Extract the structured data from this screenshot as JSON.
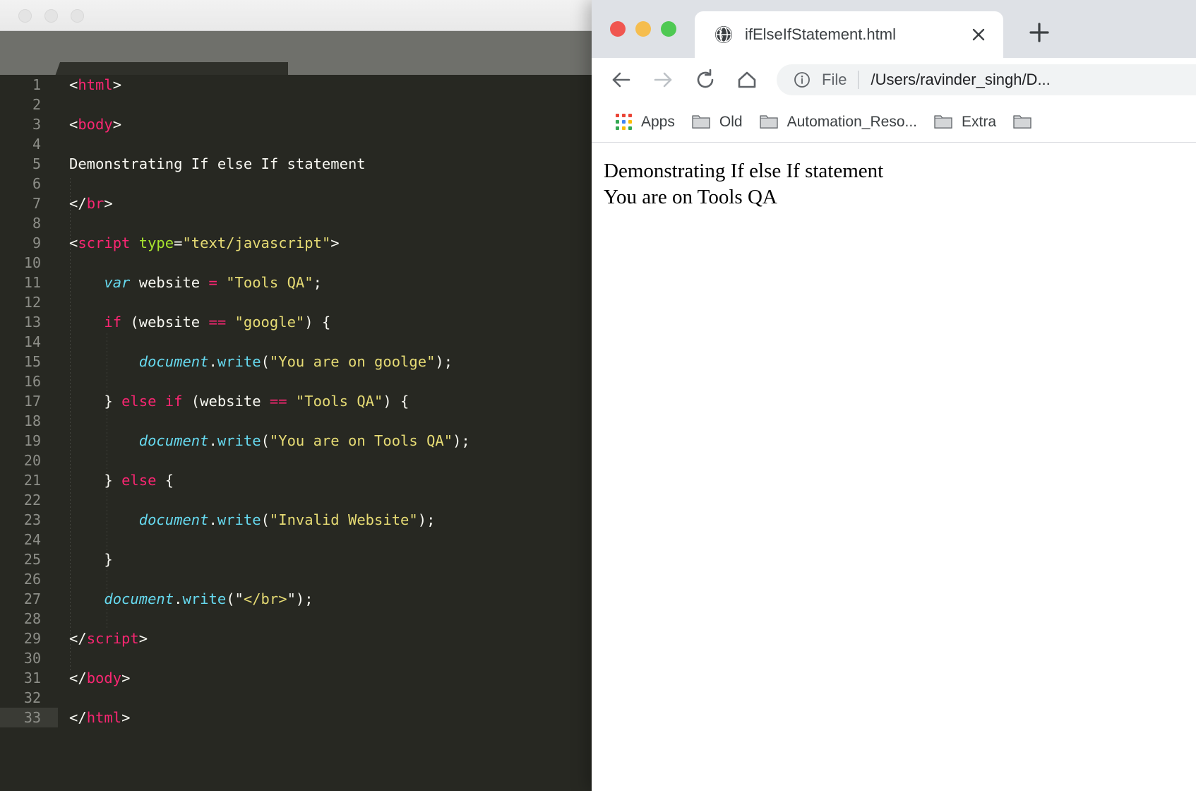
{
  "editor": {
    "window_controls": [
      "close",
      "minimize",
      "zoom"
    ],
    "nav": {
      "back_icon": "triangle-left-icon",
      "forward_icon": "triangle-right-icon"
    },
    "tab": {
      "title": "ifElseIfStatement.html",
      "close_glyph": "×"
    },
    "active_line": 33,
    "lines": [
      {
        "n": "1",
        "tokens": [
          {
            "t": "punct",
            "v": "<"
          },
          {
            "t": "tag",
            "v": "html"
          },
          {
            "t": "punct",
            "v": ">"
          }
        ]
      },
      {
        "n": "2",
        "tokens": []
      },
      {
        "n": "3",
        "tokens": [
          {
            "t": "punct",
            "v": "<"
          },
          {
            "t": "tag",
            "v": "body"
          },
          {
            "t": "punct",
            "v": ">"
          }
        ]
      },
      {
        "n": "4",
        "tokens": []
      },
      {
        "n": "5",
        "tokens": [
          {
            "t": "plain",
            "v": "Demonstrating If else If statement"
          }
        ]
      },
      {
        "n": "6",
        "tokens": []
      },
      {
        "n": "7",
        "tokens": [
          {
            "t": "punct",
            "v": "</"
          },
          {
            "t": "tag",
            "v": "br"
          },
          {
            "t": "punct",
            "v": ">"
          }
        ]
      },
      {
        "n": "8",
        "tokens": []
      },
      {
        "n": "9",
        "tokens": [
          {
            "t": "punct",
            "v": "<"
          },
          {
            "t": "tag",
            "v": "script"
          },
          {
            "t": "plain",
            "v": " "
          },
          {
            "t": "attr",
            "v": "type"
          },
          {
            "t": "punct",
            "v": "="
          },
          {
            "t": "str",
            "v": "\"text/javascript\""
          },
          {
            "t": "punct",
            "v": ">"
          }
        ]
      },
      {
        "n": "10",
        "tokens": []
      },
      {
        "n": "11",
        "tokens": [
          {
            "t": "plain",
            "v": "    "
          },
          {
            "t": "var",
            "v": "var"
          },
          {
            "t": "plain",
            "v": " website "
          },
          {
            "t": "op",
            "v": "="
          },
          {
            "t": "plain",
            "v": " "
          },
          {
            "t": "str",
            "v": "\"Tools QA\""
          },
          {
            "t": "plain",
            "v": ";"
          }
        ]
      },
      {
        "n": "12",
        "tokens": []
      },
      {
        "n": "13",
        "tokens": [
          {
            "t": "plain",
            "v": "    "
          },
          {
            "t": "kw",
            "v": "if"
          },
          {
            "t": "plain",
            "v": " (website "
          },
          {
            "t": "op",
            "v": "=="
          },
          {
            "t": "plain",
            "v": " "
          },
          {
            "t": "str",
            "v": "\"google\""
          },
          {
            "t": "plain",
            "v": ") {"
          }
        ]
      },
      {
        "n": "14",
        "tokens": []
      },
      {
        "n": "15",
        "tokens": [
          {
            "t": "plain",
            "v": "        "
          },
          {
            "t": "var",
            "v": "document"
          },
          {
            "t": "plain",
            "v": "."
          },
          {
            "t": "fn",
            "v": "write"
          },
          {
            "t": "plain",
            "v": "("
          },
          {
            "t": "str",
            "v": "\"You are on goolge\""
          },
          {
            "t": "plain",
            "v": ");"
          }
        ]
      },
      {
        "n": "16",
        "tokens": []
      },
      {
        "n": "17",
        "tokens": [
          {
            "t": "plain",
            "v": "    } "
          },
          {
            "t": "kw",
            "v": "else if"
          },
          {
            "t": "plain",
            "v": " (website "
          },
          {
            "t": "op",
            "v": "=="
          },
          {
            "t": "plain",
            "v": " "
          },
          {
            "t": "str",
            "v": "\"Tools QA\""
          },
          {
            "t": "plain",
            "v": ") {"
          }
        ]
      },
      {
        "n": "18",
        "tokens": []
      },
      {
        "n": "19",
        "tokens": [
          {
            "t": "plain",
            "v": "        "
          },
          {
            "t": "var",
            "v": "document"
          },
          {
            "t": "plain",
            "v": "."
          },
          {
            "t": "fn",
            "v": "write"
          },
          {
            "t": "plain",
            "v": "("
          },
          {
            "t": "str",
            "v": "\"You are on Tools QA\""
          },
          {
            "t": "plain",
            "v": ");"
          }
        ]
      },
      {
        "n": "20",
        "tokens": []
      },
      {
        "n": "21",
        "tokens": [
          {
            "t": "plain",
            "v": "    } "
          },
          {
            "t": "kw",
            "v": "else"
          },
          {
            "t": "plain",
            "v": " {"
          }
        ]
      },
      {
        "n": "22",
        "tokens": []
      },
      {
        "n": "23",
        "tokens": [
          {
            "t": "plain",
            "v": "        "
          },
          {
            "t": "var",
            "v": "document"
          },
          {
            "t": "plain",
            "v": "."
          },
          {
            "t": "fn",
            "v": "write"
          },
          {
            "t": "plain",
            "v": "("
          },
          {
            "t": "str",
            "v": "\"Invalid Website\""
          },
          {
            "t": "plain",
            "v": ");"
          }
        ]
      },
      {
        "n": "24",
        "tokens": []
      },
      {
        "n": "25",
        "tokens": [
          {
            "t": "plain",
            "v": "    }"
          }
        ]
      },
      {
        "n": "26",
        "tokens": []
      },
      {
        "n": "27",
        "tokens": [
          {
            "t": "plain",
            "v": "    "
          },
          {
            "t": "var",
            "v": "document"
          },
          {
            "t": "plain",
            "v": "."
          },
          {
            "t": "fn",
            "v": "write"
          },
          {
            "t": "plain",
            "v": "(\""
          },
          {
            "t": "str",
            "v": "</br>"
          },
          {
            "t": "plain",
            "v": "\");"
          }
        ]
      },
      {
        "n": "28",
        "tokens": []
      },
      {
        "n": "29",
        "tokens": [
          {
            "t": "punct",
            "v": "</"
          },
          {
            "t": "tag",
            "v": "script"
          },
          {
            "t": "punct",
            "v": ">"
          }
        ]
      },
      {
        "n": "30",
        "tokens": []
      },
      {
        "n": "31",
        "tokens": [
          {
            "t": "punct",
            "v": "</"
          },
          {
            "t": "tag",
            "v": "body"
          },
          {
            "t": "punct",
            "v": ">"
          }
        ]
      },
      {
        "n": "32",
        "tokens": []
      },
      {
        "n": "33",
        "tokens": [
          {
            "t": "punct",
            "v": "</"
          },
          {
            "t": "tag",
            "v": "html"
          },
          {
            "t": "punct",
            "v": ">"
          }
        ]
      }
    ],
    "colors": {
      "background": "#272822",
      "gutter_text": "#8d8e88",
      "tag": "#f92672",
      "keyword": "#f92672",
      "string": "#e6db74",
      "attribute": "#a6e22e",
      "variable": "#66d9ef",
      "plain": "#f8f8f2",
      "tabbar": "#6f706b",
      "tab_active": "#2f302a"
    }
  },
  "browser": {
    "window_controls": {
      "close": "#f05650",
      "minimize": "#f5bd4f",
      "maximize": "#4fc953"
    },
    "tab": {
      "title": "ifElseIfStatement.html",
      "favicon": "globe-icon",
      "close_glyph": "×"
    },
    "new_tab_label": "+",
    "toolbar": {
      "back_icon": "arrow-left-icon",
      "forward_icon": "arrow-right-icon",
      "reload_icon": "reload-icon",
      "home_icon": "home-icon"
    },
    "omnibox": {
      "info_icon": "info-circle-icon",
      "scheme_label": "File",
      "url": "/Users/ravinder_singh/D..."
    },
    "bookmarks": [
      {
        "label": "Apps",
        "icon": "apps-grid-icon"
      },
      {
        "label": "Old",
        "icon": "folder-icon"
      },
      {
        "label": "Automation_Reso...",
        "icon": "folder-icon"
      },
      {
        "label": "Extra",
        "icon": "folder-icon"
      },
      {
        "label": "",
        "icon": "folder-icon"
      }
    ],
    "apps_icon_colors": [
      "#ea4335",
      "#ea4335",
      "#ea4335",
      "#34a853",
      "#4285f4",
      "#fbbc05",
      "#34a853",
      "#fbbc05",
      "#34a853"
    ],
    "page": {
      "line1": "Demonstrating If else If statement",
      "line2": "You are on Tools QA"
    },
    "colors": {
      "tabstrip": "#dee1e6",
      "omnibox": "#f1f3f4",
      "text": "#3c4043"
    }
  }
}
